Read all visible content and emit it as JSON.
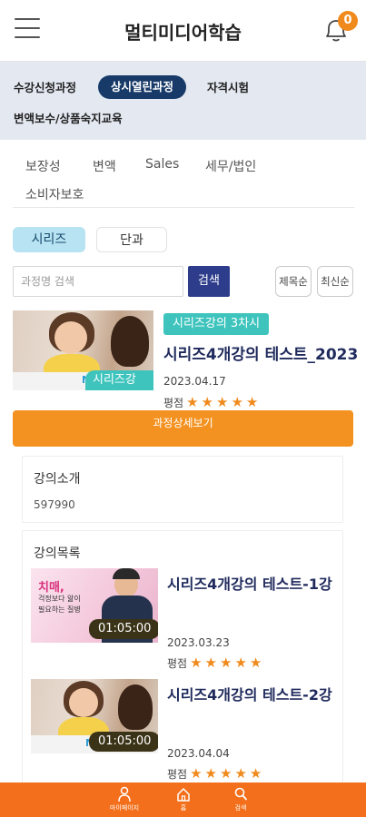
{
  "header": {
    "title": "멀티미디어학습",
    "notification_count": "0"
  },
  "categories": [
    {
      "label": "수강신청과정",
      "active": false
    },
    {
      "label": "상시열린과정",
      "active": true
    },
    {
      "label": "자격시험",
      "active": false
    },
    {
      "label": "변액보수/상품숙지교육",
      "active": false
    }
  ],
  "subtabs": [
    "보장성",
    "변액",
    "Sales",
    "세무/법인",
    "소비자보호"
  ],
  "segment": {
    "series": "시리즈",
    "single": "단과"
  },
  "search": {
    "placeholder": "과정명 검색",
    "button": "검색"
  },
  "sort": {
    "by_title": "제목순",
    "latest": "최신순"
  },
  "course": {
    "tag": "시리즈강의 3차시",
    "title": "시리즈4개강의 테스트_2023",
    "date": "2023.04.17",
    "rating_label": "평점",
    "stars": 5,
    "thumb_label": "시리즈강의",
    "thumb_logo": "MS"
  },
  "detail_button": "과정상세보기",
  "intro": {
    "title": "강의소개",
    "text": "597990"
  },
  "lesson_list": {
    "title": "강의목록",
    "items": [
      {
        "title": "시리즈4개강의 테스트-1강",
        "date": "2023.03.23",
        "duration": "01:05:00",
        "rating_label": "평점",
        "stars": 5,
        "thumb_text_1": "치매,",
        "thumb_text_2": "걱정보다 앎이",
        "thumb_text_3": "필요하는 질병"
      },
      {
        "title": "시리즈4개강의 테스트-2강",
        "date": "2023.04.04",
        "duration": "01:05:00",
        "rating_label": "평점",
        "stars": 5,
        "thumb_logo": "MS"
      }
    ]
  },
  "bottom_nav": [
    {
      "label": "마이페이지",
      "icon": "person-icon"
    },
    {
      "label": "홈",
      "icon": "home-icon"
    },
    {
      "label": "검색",
      "icon": "search-icon"
    }
  ],
  "colors": {
    "accent_orange": "#f39221",
    "nav_orange": "#f36f1b",
    "navy": "#183a68",
    "teal_tag": "#3ec4bd"
  }
}
